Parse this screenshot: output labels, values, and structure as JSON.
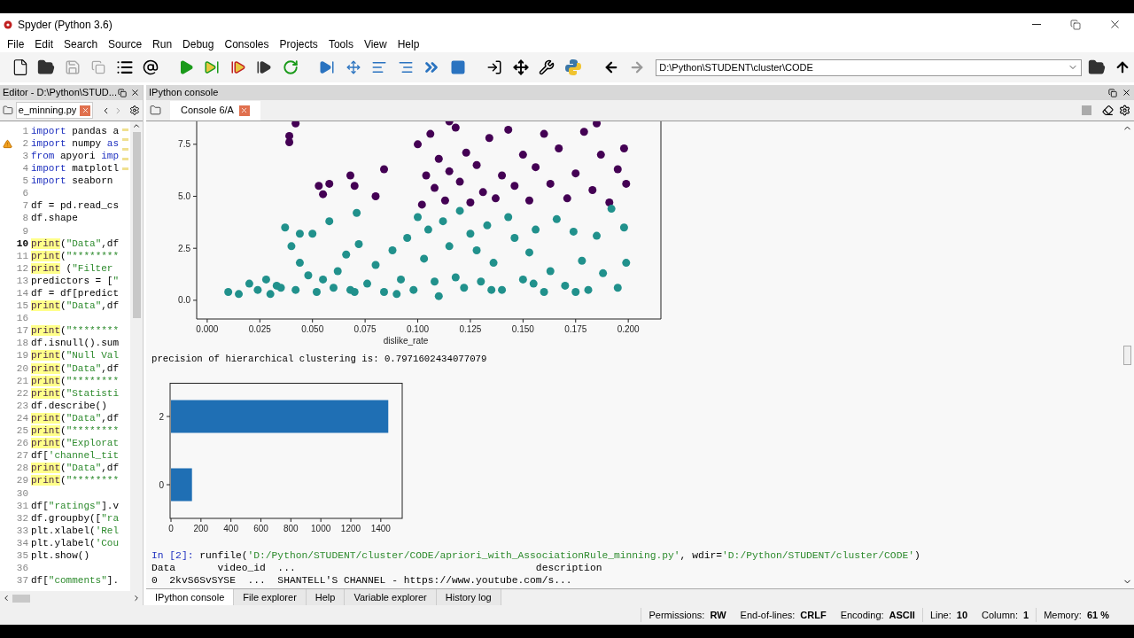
{
  "window": {
    "title": "Spyder (Python 3.6)"
  },
  "menu": [
    "File",
    "Edit",
    "Search",
    "Source",
    "Run",
    "Debug",
    "Consoles",
    "Projects",
    "Tools",
    "View",
    "Help"
  ],
  "path_field": {
    "value": "D:\\Python\\STUDENT\\cluster\\CODE"
  },
  "editor": {
    "pane_title": "Editor - D:\\Python\\STUD...",
    "tab": {
      "label": "e_minning.py"
    },
    "lines": [
      {
        "number": "1",
        "current": false,
        "warning": false,
        "segments": [
          {
            "text": "import",
            "kind": "kw"
          },
          {
            "text": " pandas a",
            "kind": "plain"
          }
        ]
      },
      {
        "number": "2",
        "current": false,
        "warning": true,
        "segments": [
          {
            "text": "import",
            "kind": "kw"
          },
          {
            "text": " numpy ",
            "kind": "plain"
          },
          {
            "text": "as",
            "kind": "kw"
          }
        ]
      },
      {
        "number": "3",
        "current": false,
        "warning": false,
        "segments": [
          {
            "text": "from",
            "kind": "kw"
          },
          {
            "text": " apyori ",
            "kind": "plain"
          },
          {
            "text": "imp",
            "kind": "kw"
          }
        ]
      },
      {
        "number": "4",
        "current": false,
        "warning": false,
        "segments": [
          {
            "text": "import",
            "kind": "kw"
          },
          {
            "text": " matplotl",
            "kind": "plain"
          }
        ]
      },
      {
        "number": "5",
        "current": false,
        "warning": false,
        "segments": [
          {
            "text": "import",
            "kind": "kw"
          },
          {
            "text": " seaborn",
            "kind": "plain"
          }
        ]
      },
      {
        "number": "6",
        "current": false,
        "warning": false
      },
      {
        "number": "7",
        "current": false,
        "warning": false,
        "segments": [
          {
            "text": "df = pd.read_cs",
            "kind": "plain"
          }
        ]
      },
      {
        "number": "8",
        "current": false,
        "warning": false,
        "segments": [
          {
            "text": "df.shape",
            "kind": "plain"
          }
        ]
      },
      {
        "number": "9",
        "current": false,
        "warning": false
      },
      {
        "number": "10",
        "current": true,
        "warning": false,
        "segments": [
          {
            "text": "print",
            "kind": "hl"
          },
          {
            "text": "(",
            "kind": "plain"
          },
          {
            "text": "\"Data\"",
            "kind": "str"
          },
          {
            "text": ",df",
            "kind": "plain"
          }
        ]
      },
      {
        "number": "11",
        "current": false,
        "warning": false,
        "segments": [
          {
            "text": "print",
            "kind": "hl"
          },
          {
            "text": "(",
            "kind": "plain"
          },
          {
            "text": "\"********",
            "kind": "str"
          }
        ]
      },
      {
        "number": "12",
        "current": false,
        "warning": false,
        "segments": [
          {
            "text": "print",
            "kind": "hl"
          },
          {
            "text": " (",
            "kind": "plain"
          },
          {
            "text": "\"Filter ",
            "kind": "str"
          }
        ]
      },
      {
        "number": "13",
        "current": false,
        "warning": false,
        "segments": [
          {
            "text": "predictors = [",
            "kind": "plain"
          },
          {
            "text": "\"",
            "kind": "str"
          }
        ]
      },
      {
        "number": "14",
        "current": false,
        "warning": false,
        "segments": [
          {
            "text": "df = df[predict",
            "kind": "plain"
          }
        ]
      },
      {
        "number": "15",
        "current": false,
        "warning": false,
        "segments": [
          {
            "text": "print",
            "kind": "hl"
          },
          {
            "text": "(",
            "kind": "plain"
          },
          {
            "text": "\"Data\"",
            "kind": "str"
          },
          {
            "text": ",df",
            "kind": "plain"
          }
        ]
      },
      {
        "number": "16",
        "current": false,
        "warning": false
      },
      {
        "number": "17",
        "current": false,
        "warning": false,
        "segments": [
          {
            "text": "print",
            "kind": "hl"
          },
          {
            "text": "(",
            "kind": "plain"
          },
          {
            "text": "\"********",
            "kind": "str"
          }
        ]
      },
      {
        "number": "18",
        "current": false,
        "warning": false,
        "segments": [
          {
            "text": "df.isnull().sum",
            "kind": "plain"
          }
        ]
      },
      {
        "number": "19",
        "current": false,
        "warning": false,
        "segments": [
          {
            "text": "print",
            "kind": "hl"
          },
          {
            "text": "(",
            "kind": "plain"
          },
          {
            "text": "\"Null Val",
            "kind": "str"
          }
        ]
      },
      {
        "number": "20",
        "current": false,
        "warning": false,
        "segments": [
          {
            "text": "print",
            "kind": "hl"
          },
          {
            "text": "(",
            "kind": "plain"
          },
          {
            "text": "\"Data\"",
            "kind": "str"
          },
          {
            "text": ",df",
            "kind": "plain"
          }
        ]
      },
      {
        "number": "21",
        "current": false,
        "warning": false,
        "segments": [
          {
            "text": "print",
            "kind": "hl"
          },
          {
            "text": "(",
            "kind": "plain"
          },
          {
            "text": "\"********",
            "kind": "str"
          }
        ]
      },
      {
        "number": "22",
        "current": false,
        "warning": false,
        "segments": [
          {
            "text": "print",
            "kind": "hl"
          },
          {
            "text": "(",
            "kind": "plain"
          },
          {
            "text": "\"Statisti",
            "kind": "str"
          }
        ]
      },
      {
        "number": "23",
        "current": false,
        "warning": false,
        "segments": [
          {
            "text": "df.describe()",
            "kind": "plain"
          }
        ]
      },
      {
        "number": "24",
        "current": false,
        "warning": false,
        "segments": [
          {
            "text": "print",
            "kind": "hl"
          },
          {
            "text": "(",
            "kind": "plain"
          },
          {
            "text": "\"Data\"",
            "kind": "str"
          },
          {
            "text": ",df",
            "kind": "plain"
          }
        ]
      },
      {
        "number": "25",
        "current": false,
        "warning": false,
        "segments": [
          {
            "text": "print",
            "kind": "hl"
          },
          {
            "text": "(",
            "kind": "plain"
          },
          {
            "text": "\"********",
            "kind": "str"
          }
        ]
      },
      {
        "number": "26",
        "current": false,
        "warning": false,
        "segments": [
          {
            "text": "print",
            "kind": "hl"
          },
          {
            "text": "(",
            "kind": "plain"
          },
          {
            "text": "\"Explorat",
            "kind": "str"
          }
        ]
      },
      {
        "number": "27",
        "current": false,
        "warning": false,
        "segments": [
          {
            "text": "df[",
            "kind": "plain"
          },
          {
            "text": "'channel_tit",
            "kind": "str"
          }
        ]
      },
      {
        "number": "28",
        "current": false,
        "warning": false,
        "segments": [
          {
            "text": "print",
            "kind": "hl"
          },
          {
            "text": "(",
            "kind": "plain"
          },
          {
            "text": "\"Data\"",
            "kind": "str"
          },
          {
            "text": ",df",
            "kind": "plain"
          }
        ]
      },
      {
        "number": "29",
        "current": false,
        "warning": false,
        "segments": [
          {
            "text": "print",
            "kind": "hl"
          },
          {
            "text": "(",
            "kind": "plain"
          },
          {
            "text": "\"********",
            "kind": "str"
          }
        ]
      },
      {
        "number": "30",
        "current": false,
        "warning": false
      },
      {
        "number": "31",
        "current": false,
        "warning": false,
        "segments": [
          {
            "text": "df[",
            "kind": "plain"
          },
          {
            "text": "\"ratings\"",
            "kind": "str"
          },
          {
            "text": "].v",
            "kind": "plain"
          }
        ]
      },
      {
        "number": "32",
        "current": false,
        "warning": false,
        "segments": [
          {
            "text": "df.groupby([",
            "kind": "plain"
          },
          {
            "text": "\"ra",
            "kind": "str"
          }
        ]
      },
      {
        "number": "33",
        "current": false,
        "warning": false,
        "segments": [
          {
            "text": "plt.xlabel(",
            "kind": "plain"
          },
          {
            "text": "'Rel",
            "kind": "str"
          }
        ]
      },
      {
        "number": "34",
        "current": false,
        "warning": false,
        "segments": [
          {
            "text": "plt.ylabel(",
            "kind": "plain"
          },
          {
            "text": "'Cou",
            "kind": "str"
          }
        ]
      },
      {
        "number": "35",
        "current": false,
        "warning": false,
        "segments": [
          {
            "text": "plt.show()",
            "kind": "plain"
          }
        ]
      },
      {
        "number": "36",
        "current": false,
        "warning": false
      },
      {
        "number": "37",
        "current": false,
        "warning": false,
        "segments": [
          {
            "text": "df[",
            "kind": "plain"
          },
          {
            "text": "\"comments\"",
            "kind": "str"
          },
          {
            "text": "].",
            "kind": "plain"
          }
        ]
      }
    ]
  },
  "console": {
    "pane_title": "IPython console",
    "tab": {
      "label": "Console 6/A"
    },
    "scatter": {
      "chart_data": {
        "type": "scatter",
        "xlabel": "dislike_rate",
        "xlim": [
          -0.005,
          0.2155
        ],
        "ylim": [
          -0.9,
          8.6
        ],
        "xticks": [
          {
            "value": 0,
            "label": "0.000"
          },
          {
            "value": 0.025,
            "label": "0.025"
          },
          {
            "value": 0.05,
            "label": "0.050"
          },
          {
            "value": 0.075,
            "label": "0.075"
          },
          {
            "value": 0.1,
            "label": "0.100"
          },
          {
            "value": 0.125,
            "label": "0.125"
          },
          {
            "value": 0.15,
            "label": "0.150"
          },
          {
            "value": 0.175,
            "label": "0.175"
          },
          {
            "value": 0.2,
            "label": "0.200"
          }
        ],
        "yticks": [
          {
            "value": 0,
            "label": "0.0"
          },
          {
            "value": 2.5,
            "label": "2.5"
          },
          {
            "value": 5,
            "label": "5.0"
          },
          {
            "value": 7.5,
            "label": "7.5"
          }
        ],
        "series": [
          {
            "color": "#440154",
            "x": [
              0.039,
              0.039,
              0.042,
              0.053,
              0.055,
              0.058,
              0.068,
              0.07,
              0.08,
              0.084,
              0.1,
              0.102,
              0.104,
              0.106,
              0.108,
              0.11,
              0.113,
              0.115,
              0.118,
              0.12,
              0.123,
              0.125,
              0.128,
              0.131,
              0.134,
              0.137,
              0.14,
              0.143,
              0.146,
              0.15,
              0.153,
              0.156,
              0.16,
              0.163,
              0.167,
              0.171,
              0.175,
              0.179,
              0.183,
              0.187,
              0.191,
              0.195,
              0.198,
              0.199,
              0.185,
              0.115
            ],
            "values": [
              7.6,
              7.9,
              8.5,
              5.5,
              5.1,
              5.6,
              6.0,
              5.5,
              5.0,
              6.3,
              7.5,
              4.6,
              6.0,
              8.0,
              5.4,
              6.8,
              4.8,
              6.2,
              8.3,
              5.7,
              7.1,
              4.7,
              6.5,
              5.2,
              7.8,
              4.9,
              6.0,
              8.2,
              5.5,
              7.0,
              4.8,
              6.4,
              8.0,
              5.6,
              7.3,
              4.9,
              6.1,
              8.1,
              5.3,
              7.0,
              4.7,
              6.3,
              7.3,
              5.6,
              8.5,
              8.6
            ]
          },
          {
            "color": "#21918c",
            "x": [
              0.01,
              0.015,
              0.02,
              0.024,
              0.028,
              0.03,
              0.033,
              0.037,
              0.04,
              0.042,
              0.044,
              0.044,
              0.048,
              0.05,
              0.052,
              0.055,
              0.058,
              0.06,
              0.062,
              0.066,
              0.068,
              0.071,
              0.072,
              0.076,
              0.08,
              0.084,
              0.088,
              0.092,
              0.095,
              0.098,
              0.1,
              0.103,
              0.105,
              0.108,
              0.11,
              0.112,
              0.115,
              0.118,
              0.12,
              0.122,
              0.125,
              0.128,
              0.13,
              0.133,
              0.136,
              0.14,
              0.143,
              0.146,
              0.15,
              0.153,
              0.156,
              0.16,
              0.163,
              0.166,
              0.17,
              0.174,
              0.178,
              0.181,
              0.185,
              0.188,
              0.192,
              0.195,
              0.198,
              0.199,
              0.09,
              0.07,
              0.035,
              0.135,
              0.155,
              0.175
            ],
            "values": [
              0.4,
              0.3,
              0.8,
              0.5,
              1.0,
              0.3,
              0.7,
              3.5,
              2.6,
              0.5,
              1.8,
              3.2,
              1.2,
              3.2,
              0.4,
              1.0,
              3.8,
              0.6,
              1.4,
              2.2,
              0.5,
              4.2,
              2.7,
              0.8,
              1.7,
              0.4,
              2.4,
              1.0,
              3.0,
              0.5,
              4.0,
              2.0,
              3.4,
              0.9,
              0.2,
              3.8,
              2.6,
              1.1,
              4.3,
              0.6,
              3.2,
              2.4,
              0.9,
              3.6,
              1.8,
              0.5,
              4.0,
              3.0,
              1.0,
              2.3,
              3.4,
              0.4,
              1.4,
              3.9,
              0.7,
              3.3,
              1.9,
              0.5,
              3.1,
              1.3,
              4.4,
              0.6,
              3.5,
              1.8,
              0.3,
              0.4,
              0.6,
              0.5,
              0.8,
              0.4
            ]
          }
        ]
      }
    },
    "precision_text": "precision of hierarchical clustering is: 0.7971602434077079",
    "bar": {
      "chart_data": {
        "type": "bar",
        "orientation": "horizontal",
        "categories": [
          "2",
          "0"
        ],
        "xlim": [
          -6,
          1543
        ],
        "xticks": [
          0,
          200,
          400,
          600,
          800,
          1000,
          1200,
          1400
        ],
        "series": [
          {
            "color": "#1f6fb4",
            "values": [
              1450,
              140
            ]
          }
        ]
      }
    },
    "lines": [
      {
        "segments": [
          {
            "text": "In [2]: ",
            "kind": "prompt"
          },
          {
            "text": "runfile(",
            "kind": "plain"
          },
          {
            "text": "'D:/Python/STUDENT/cluster/CODE/apriori_with_AssociationRule_minning.py'",
            "kind": "str"
          },
          {
            "text": ", wdir=",
            "kind": "plain"
          },
          {
            "text": "'D:/Python/STUDENT/cluster/CODE'",
            "kind": "str"
          },
          {
            "text": ")",
            "kind": "plain"
          }
        ]
      },
      {
        "segments": [
          {
            "text": "Data       video_id  ...                                        description",
            "kind": "plain"
          }
        ]
      },
      {
        "segments": [
          {
            "text": "0  2kvS6SvSYSE  ...  SHANTELL'S CHANNEL - https://www.youtube.com/s...",
            "kind": "plain"
          }
        ]
      }
    ]
  },
  "bottom_tabs": [
    {
      "label": "IPython console",
      "selected": true
    },
    {
      "label": "File explorer",
      "selected": false
    },
    {
      "label": "Help",
      "selected": false
    },
    {
      "label": "Variable explorer",
      "selected": false
    },
    {
      "label": "History log",
      "selected": false
    }
  ],
  "status_bar": [
    {
      "label": "Permissions:",
      "value": "RW"
    },
    {
      "label": "End-of-lines:",
      "value": "CRLF"
    },
    {
      "label": "Encoding:",
      "value": "ASCII"
    },
    {
      "label": "Line:",
      "value": "10"
    },
    {
      "label": "Column:",
      "value": "1"
    },
    {
      "label": "Memory:",
      "value": "61 %"
    }
  ]
}
